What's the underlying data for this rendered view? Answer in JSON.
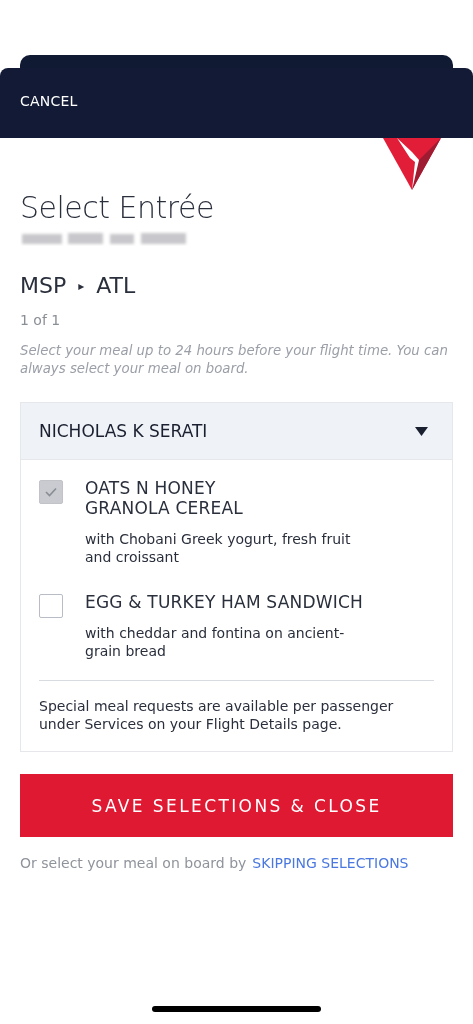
{
  "header": {
    "cancel": "CANCEL"
  },
  "title": "Select Entrée",
  "route": {
    "origin": "MSP",
    "separator": "▸",
    "destination": "ATL"
  },
  "pager": "1 of 1",
  "note": "Select your meal up to 24 hours before your flight time. You can always select your meal on board.",
  "passenger": {
    "name": "NICHOLAS K SERATI",
    "expanded": true
  },
  "meals": [
    {
      "name": "OATS N HONEY\nGRANOLA CEREAL",
      "description": "with Chobani Greek yogurt, fresh fruit\nand croissant",
      "checked": true
    },
    {
      "name": "EGG & TURKEY HAM SANDWICH",
      "description": "with cheddar and fontina on ancient-\ngrain bread",
      "checked": false
    }
  ],
  "special_note": "Special meal requests are available per passenger under Services on your Flight Details page.",
  "save_button": "SAVE SELECTIONS & CLOSE",
  "footer": {
    "text": "Or select your meal on board by",
    "link": "SKIPPING SELECTIONS"
  }
}
